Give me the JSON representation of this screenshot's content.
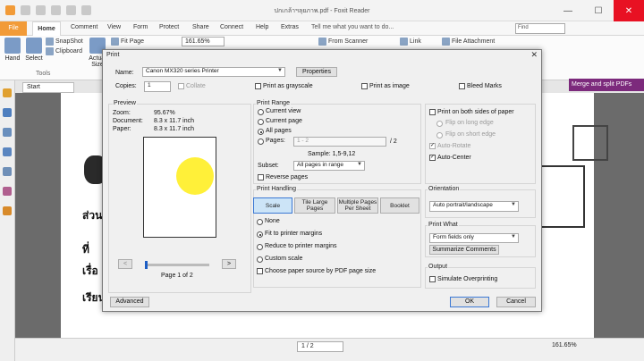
{
  "window": {
    "title": "ปกเกล้าฯลุยภาพ.pdf - Foxit Reader",
    "min": "—",
    "max": "☐",
    "close": "✕"
  },
  "ribbon_tabs": [
    "File",
    "Home",
    "Comment",
    "View",
    "Form",
    "Protect",
    "Share",
    "Connect",
    "Help",
    "Extras"
  ],
  "tell_me": "Tell me what you want to do...",
  "find": "Find",
  "ribbon": {
    "hand": "Hand",
    "select": "Select",
    "snapshot": "SnapShot",
    "clipboard": "Clipboard",
    "actual_size": "Actual Size",
    "fit_page": "Fit Page",
    "zoom": "161.65%",
    "from_scanner": "From Scanner",
    "link": "Link",
    "file_attachment": "File Attachment",
    "tools_label": "Tools"
  },
  "doc_tab": "Start",
  "merge_banner": "Merge and split PDFs",
  "doc_text": {
    "line1": "ส่วน",
    "line2": "ที่",
    "line3": "เรื่อ",
    "line4": "เรียน"
  },
  "statusbar": {
    "page": "1 / 2",
    "zoom": "161.65%"
  },
  "dialog": {
    "title": "Print",
    "name_label": "Name:",
    "printer": "Canon MX320 series Printer",
    "properties": "Properties",
    "copies_label": "Copies:",
    "copies_value": "1",
    "collate": "Collate",
    "print_grayscale": "Print as grayscale",
    "print_image": "Print as image",
    "bleed_marks": "Bleed Marks",
    "preview": {
      "title": "Preview",
      "zoom_label": "Zoom:",
      "zoom_value": "95.67%",
      "document_label": "Document:",
      "document_value": "8.3 x 11.7 inch",
      "paper_label": "Paper:",
      "paper_value": "8.3 x 11.7 inch",
      "page_of": "Page 1 of 2",
      "prev": "<",
      "next": ">",
      "position_fraction": 0.0
    },
    "print_range": {
      "title": "Print Range",
      "current_view": "Current view",
      "current_page": "Current page",
      "all_pages": "All pages",
      "pages": "Pages:",
      "pages_value": "1 - 2",
      "pages_total": "/ 2",
      "sample": "Sample: 1,5-9,12",
      "subset_label": "Subset:",
      "subset_value": "All pages in range",
      "reverse_pages": "Reverse pages"
    },
    "print_handling": {
      "title": "Print Handling",
      "scale": "Scale",
      "tile_large_pages": "Tile Large Pages",
      "multiple_pages": "Multiple Pages Per Sheet",
      "booklet": "Booklet",
      "none": "None",
      "fit_margins": "Fit to printer margins",
      "reduce_margins": "Reduce to printer margins",
      "custom_scale": "Custom scale",
      "paper_source": "Choose paper source by PDF page size"
    },
    "duplex": {
      "both_sides": "Print on both sides of paper",
      "flip_long": "Flip on long edge",
      "flip_short": "Flip on short edge",
      "auto_rotate": "Auto-Rotate",
      "auto_center": "Auto-Center"
    },
    "orientation": {
      "title": "Orientation",
      "value": "Auto portrait/landscape"
    },
    "print_what": {
      "title": "Print What",
      "value": "Form fields only",
      "summarize": "Summarize Comments"
    },
    "output": {
      "title": "Output",
      "simulate": "Simulate Overprinting"
    },
    "advanced": "Advanced",
    "ok": "OK",
    "cancel": "Cancel"
  },
  "colors": {
    "file_tab": "#f29b38",
    "merge_banner": "#7c2a7c",
    "highlight": "#ffef2e"
  }
}
